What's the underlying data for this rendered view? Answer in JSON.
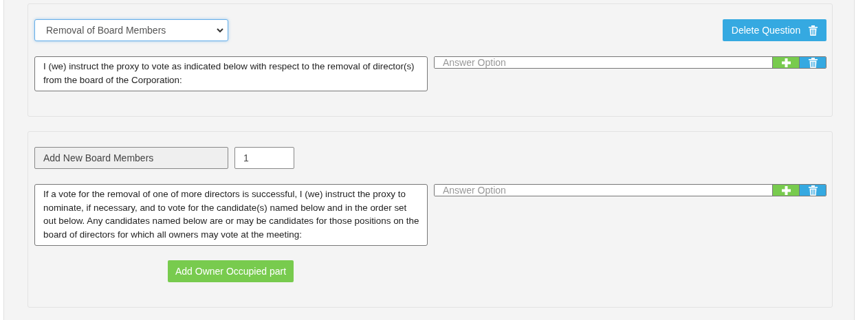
{
  "questions": [
    {
      "kind": "select",
      "type_select": {
        "value": "Removal of Board Members",
        "focused": true
      },
      "delete_button": "Delete Question",
      "question_text": "I (we) instruct the proxy to vote as indicated below with respect to the removal of director(s) from the board of the Corporation:",
      "answer_options": [
        {
          "placeholder": "Answer Option"
        }
      ]
    },
    {
      "kind": "board",
      "label": "Add New Board Members",
      "count": "1",
      "question_text": "If a vote for the removal of one of more directors is successful, I (we) instruct the proxy to nominate, if necessary, and to vote for the candidate(s) named below and in the order set out below. Any candidates named below are or may be candidates for those positions on the board of directors for which all owners may vote at the meeting:",
      "answer_options": [
        {
          "placeholder": "Answer Option"
        }
      ],
      "add_button": "Add Owner Occupied part"
    }
  ]
}
